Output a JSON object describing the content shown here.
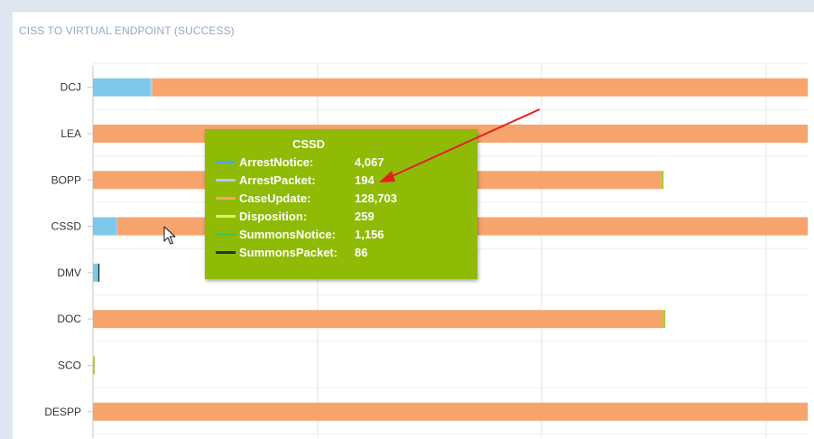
{
  "chart_data": {
    "type": "bar",
    "orientation": "horizontal",
    "stacked": true,
    "title": "CISS TO VIRTUAL ENDPOINT (SUCCESS)",
    "categories": [
      "DCJ",
      "LEA",
      "BOPP",
      "CSSD",
      "DMV",
      "DOC",
      "SCO",
      "DESPP"
    ],
    "series": [
      {
        "name": "ArrestNotice",
        "color": "#7ec8ea",
        "values": [
          10000,
          0,
          0,
          4067,
          900,
          0,
          0,
          0
        ]
      },
      {
        "name": "ArrestPacket",
        "color": "#b6c8ee",
        "values": [
          300,
          0,
          0,
          194,
          0,
          0,
          0,
          0
        ]
      },
      {
        "name": "CaseUpdate",
        "color": "#f7a46d",
        "values": [
          130000,
          130000,
          98600,
          128703,
          0,
          98900,
          0,
          130000
        ]
      },
      {
        "name": "Disposition",
        "color": "#a8cf2a",
        "values": [
          1100,
          1800,
          400,
          259,
          0,
          400,
          300,
          0
        ]
      },
      {
        "name": "SummonsNotice",
        "color": "#4ec86e",
        "values": [
          0,
          0,
          0,
          1156,
          0,
          0,
          0,
          0
        ]
      },
      {
        "name": "SummonsPacket",
        "color": "#1d3a2c",
        "values": [
          0,
          0,
          0,
          86,
          150,
          0,
          0,
          0
        ]
      }
    ],
    "xlim": [
      0,
      124000
    ],
    "grid": true,
    "legend": "none",
    "tooltip": {
      "title": "CSSD",
      "rows": [
        {
          "label": "ArrestNotice:",
          "value": "4,067",
          "color": "#4aa8e8"
        },
        {
          "label": "ArrestPacket:",
          "value": "194",
          "color": "#b6c8ee"
        },
        {
          "label": "CaseUpdate:",
          "value": "128,703",
          "color": "#f7a46d"
        },
        {
          "label": "Disposition:",
          "value": "259",
          "color": "#d6f06a"
        },
        {
          "label": "SummonsNotice:",
          "value": "1,156",
          "color": "#3cc46a"
        },
        {
          "label": "SummonsPacket:",
          "value": "86",
          "color": "#1d3a2c"
        }
      ]
    },
    "annotation": {
      "type": "arrow",
      "color": "#e02020"
    }
  }
}
